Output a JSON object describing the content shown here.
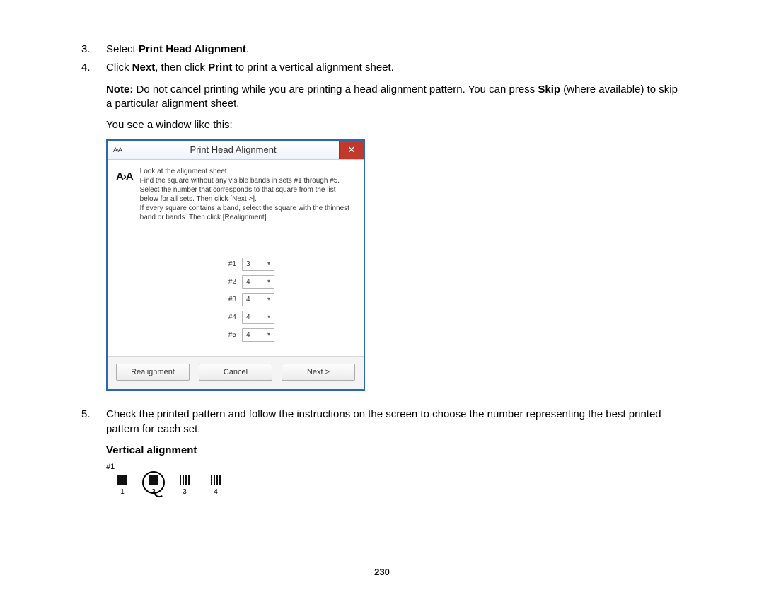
{
  "steps": {
    "s3": {
      "num": "3.",
      "pre": "Select ",
      "bold": "Print Head Alignment",
      "post": "."
    },
    "s4": {
      "num": "4.",
      "line_a": "Click ",
      "line_b": "Next",
      "line_c": ", then click ",
      "line_d": "Print",
      "line_e": " to print a vertical alignment sheet.",
      "note_label": "Note:",
      "note_text": " Do not cancel printing while you are printing a head alignment pattern. You can press ",
      "note_bold": "Skip",
      "note_tail": " (where available) to skip a particular alignment sheet.",
      "window_intro": "You see a window like this:"
    },
    "s5": {
      "num": "5.",
      "text": "Check the printed pattern and follow the instructions on the screen to choose the number representing the best printed pattern for each set."
    }
  },
  "dialog": {
    "small_logo": "A›A",
    "title": "Print Head Alignment",
    "big_logo": "A›A",
    "instructions": "Look at the alignment sheet.\nFind the square without any visible bands in sets #1 through #5. Select the number that corresponds to that square from the list below for all sets. Then click [Next >].\nIf every square contains a band, select the square with the thinnest band or bands. Then click [Realignment].",
    "rows": [
      {
        "label": "#1",
        "value": "3"
      },
      {
        "label": "#2",
        "value": "4"
      },
      {
        "label": "#3",
        "value": "4"
      },
      {
        "label": "#4",
        "value": "4"
      },
      {
        "label": "#5",
        "value": "4"
      }
    ],
    "buttons": {
      "realign": "Realignment",
      "cancel": "Cancel",
      "next": "Next >"
    }
  },
  "vertical_heading": "Vertical alignment",
  "pattern": {
    "set": "#1",
    "labels": [
      "1",
      "2",
      "3",
      "4"
    ]
  },
  "page_number": "230"
}
